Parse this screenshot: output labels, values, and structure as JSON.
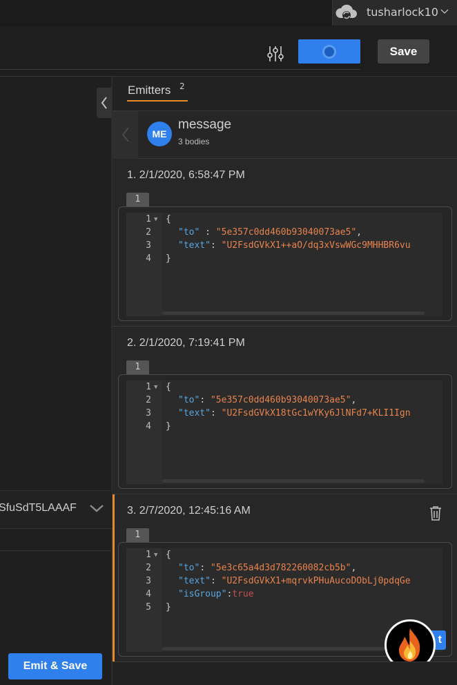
{
  "user": {
    "name": "tusharlock10",
    "avatar_icon": "cloud-sync-icon"
  },
  "toolbar": {
    "settings_icon": "sliders-icon",
    "save_label": "Save",
    "toggle_color": "#2f80ed"
  },
  "left_panel": {
    "partial_text": "SfuSdT5LAAAF",
    "emit_save_label": "Emit & Save"
  },
  "tabs": {
    "emitters_label": "Emitters",
    "emitters_count": "2"
  },
  "message": {
    "avatar": "ME",
    "title": "message",
    "subtitle": "3 bodies"
  },
  "bodies": [
    {
      "title": "1. 2/1/2020, 6:58:47 PM",
      "tag": "1",
      "lines": [
        {
          "n": "1",
          "fold": true,
          "text": "{"
        },
        {
          "n": "2",
          "key": "\"to\"",
          "sep": " : ",
          "val": "\"5e357c0dd460b93040073ae5\"",
          "trail": ","
        },
        {
          "n": "3",
          "key": "\"text\"",
          "sep": ": ",
          "val": "\"U2FsdGVkX1++aO/dq3xVswWGc9MHHBR6vu",
          "trail": ""
        },
        {
          "n": "4",
          "text": "}"
        }
      ]
    },
    {
      "title": "2. 2/1/2020, 7:19:41 PM",
      "tag": "1",
      "lines": [
        {
          "n": "1",
          "fold": true,
          "text": "{"
        },
        {
          "n": "2",
          "key": "\"to\"",
          "sep": ": ",
          "val": "\"5e357c0dd460b93040073ae5\"",
          "trail": ","
        },
        {
          "n": "3",
          "key": "\"text\"",
          "sep": ": ",
          "val": "\"U2FsdGVkX18tGc1wYKy6JlNFd7+KLI1Ign",
          "trail": ""
        },
        {
          "n": "4",
          "text": "}"
        }
      ]
    },
    {
      "title": "3. 2/7/2020, 12:45:16 AM",
      "tag": "1",
      "lines": [
        {
          "n": "1",
          "fold": true,
          "text": "{"
        },
        {
          "n": "2",
          "key": "\"to\"",
          "sep": ": ",
          "val": "\"5e3c65a4d3d782260082cb5b\"",
          "trail": ","
        },
        {
          "n": "3",
          "key": "\"text\"",
          "sep": ": ",
          "val": "\"U2FsdGVkX1+mqrvkPHuAucoDObLj0pdqGe",
          "trail": ""
        },
        {
          "n": "4",
          "key": "\"isGroup\"",
          "sep": ":",
          "bool": "true",
          "trail": ""
        },
        {
          "n": "5",
          "text": "}"
        }
      ]
    }
  ],
  "colors": {
    "accent_blue": "#2f80ed",
    "accent_orange": "#e8892a"
  },
  "copy_partial_label": "t"
}
